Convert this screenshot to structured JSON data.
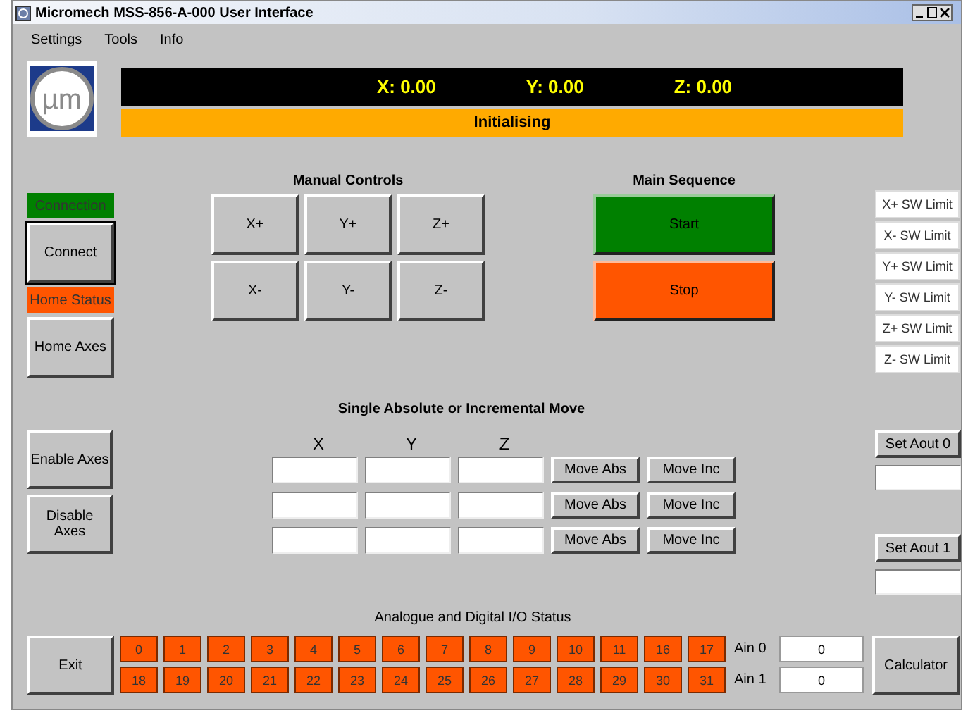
{
  "window": {
    "title": "Micromech MSS-856-A-000 User Interface"
  },
  "menu": [
    "Settings",
    "Tools",
    "Info"
  ],
  "logo": {
    "text": "µm"
  },
  "position": [
    "X: 0.00",
    "Y: 0.00",
    "Z: 0.00"
  ],
  "status": {
    "text": "Initialising",
    "color": "#ffaa00"
  },
  "left_panel": [
    {
      "kind": "indicator",
      "label": "Connection",
      "color": "#008000"
    },
    {
      "kind": "button",
      "label": "Connect",
      "selected": true
    },
    {
      "kind": "indicator",
      "label": "Home Status",
      "color": "#ff5500"
    },
    {
      "kind": "button",
      "label": "Home Axes",
      "selected": false
    }
  ],
  "manual_controls": {
    "title": "Manual Controls",
    "buttons": [
      "X+",
      "Y+",
      "Z+",
      "X-",
      "Y-",
      "Z-"
    ]
  },
  "main_sequence": {
    "title": "Main Sequence",
    "buttons": [
      {
        "label": "Start",
        "color": "#008000"
      },
      {
        "label": "Stop",
        "color": "#ff5500"
      }
    ]
  },
  "limits": [
    "X+ SW Limit",
    "X- SW Limit",
    "Y+ SW Limit",
    "Y- SW Limit",
    "Z+ SW Limit",
    "Z- SW Limit"
  ],
  "axes_buttons": [
    "Enable Axes",
    "Disable Axes"
  ],
  "move": {
    "title": "Single Absolute or Incremental Move",
    "columns": [
      "X",
      "Y",
      "Z"
    ],
    "rows": [
      {
        "buttons": [
          "Move Abs",
          "Move Inc"
        ]
      },
      {
        "buttons": [
          "Move Abs",
          "Move Inc"
        ]
      },
      {
        "buttons": [
          "Move Abs",
          "Move Inc"
        ]
      }
    ]
  },
  "aout": [
    "Set Aout 0",
    "Set Aout 1"
  ],
  "io": {
    "title": "Analogue and Digital I/O Status",
    "bits": [
      {
        "label": "0",
        "color": "#ff5500"
      },
      {
        "label": "1",
        "color": "#ff5500"
      },
      {
        "label": "2",
        "color": "#ff5500"
      },
      {
        "label": "3",
        "color": "#ff5500"
      },
      {
        "label": "4",
        "color": "#ff5500"
      },
      {
        "label": "5",
        "color": "#ff5500"
      },
      {
        "label": "6",
        "color": "#ff5500"
      },
      {
        "label": "7",
        "color": "#ff5500"
      },
      {
        "label": "8",
        "color": "#ff5500"
      },
      {
        "label": "9",
        "color": "#ff5500"
      },
      {
        "label": "10",
        "color": "#ff5500"
      },
      {
        "label": "11",
        "color": "#ff5500"
      },
      {
        "label": "16",
        "color": "#ff5500"
      },
      {
        "label": "17",
        "color": "#ff5500"
      },
      {
        "label": "18",
        "color": "#ff5500"
      },
      {
        "label": "19",
        "color": "#ff5500"
      },
      {
        "label": "20",
        "color": "#ff5500"
      },
      {
        "label": "21",
        "color": "#ff5500"
      },
      {
        "label": "22",
        "color": "#ff5500"
      },
      {
        "label": "23",
        "color": "#ff5500"
      },
      {
        "label": "24",
        "color": "#ff5500"
      },
      {
        "label": "25",
        "color": "#ff5500"
      },
      {
        "label": "26",
        "color": "#ff5500"
      },
      {
        "label": "27",
        "color": "#ff5500"
      },
      {
        "label": "28",
        "color": "#ff5500"
      },
      {
        "label": "29",
        "color": "#ff5500"
      },
      {
        "label": "30",
        "color": "#ff5500"
      },
      {
        "label": "31",
        "color": "#ff5500"
      }
    ],
    "analog": [
      {
        "label": "Ain 0",
        "value": "0"
      },
      {
        "label": "Ain 1",
        "value": "0"
      }
    ]
  },
  "exit": "Exit",
  "calculator": "Calculator"
}
